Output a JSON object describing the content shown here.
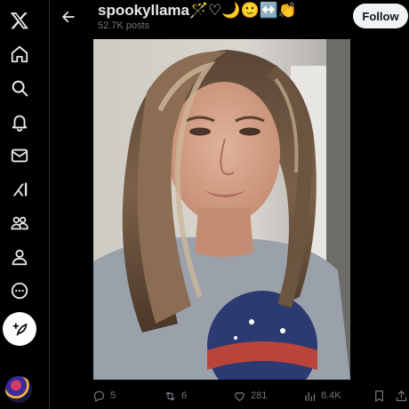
{
  "header": {
    "username": "spookyllama🪄♡🌙🙂↔️👏",
    "post_count": "52.7K posts",
    "follow_label": "Follow"
  },
  "nav": {
    "items": [
      "x-logo",
      "home",
      "explore",
      "notifications",
      "messages",
      "grok",
      "communities",
      "profile",
      "more"
    ],
    "compose_icon": "feather-plus-icon"
  },
  "photo": {
    "description_icon": "photo"
  },
  "actions": {
    "replies": "5",
    "reposts": "6",
    "likes": "281",
    "views": "8.4K"
  },
  "colors": {
    "background": "#000000",
    "text": "#e7e9ea",
    "muted": "#71767b",
    "follow_bg": "#eff3f4"
  }
}
